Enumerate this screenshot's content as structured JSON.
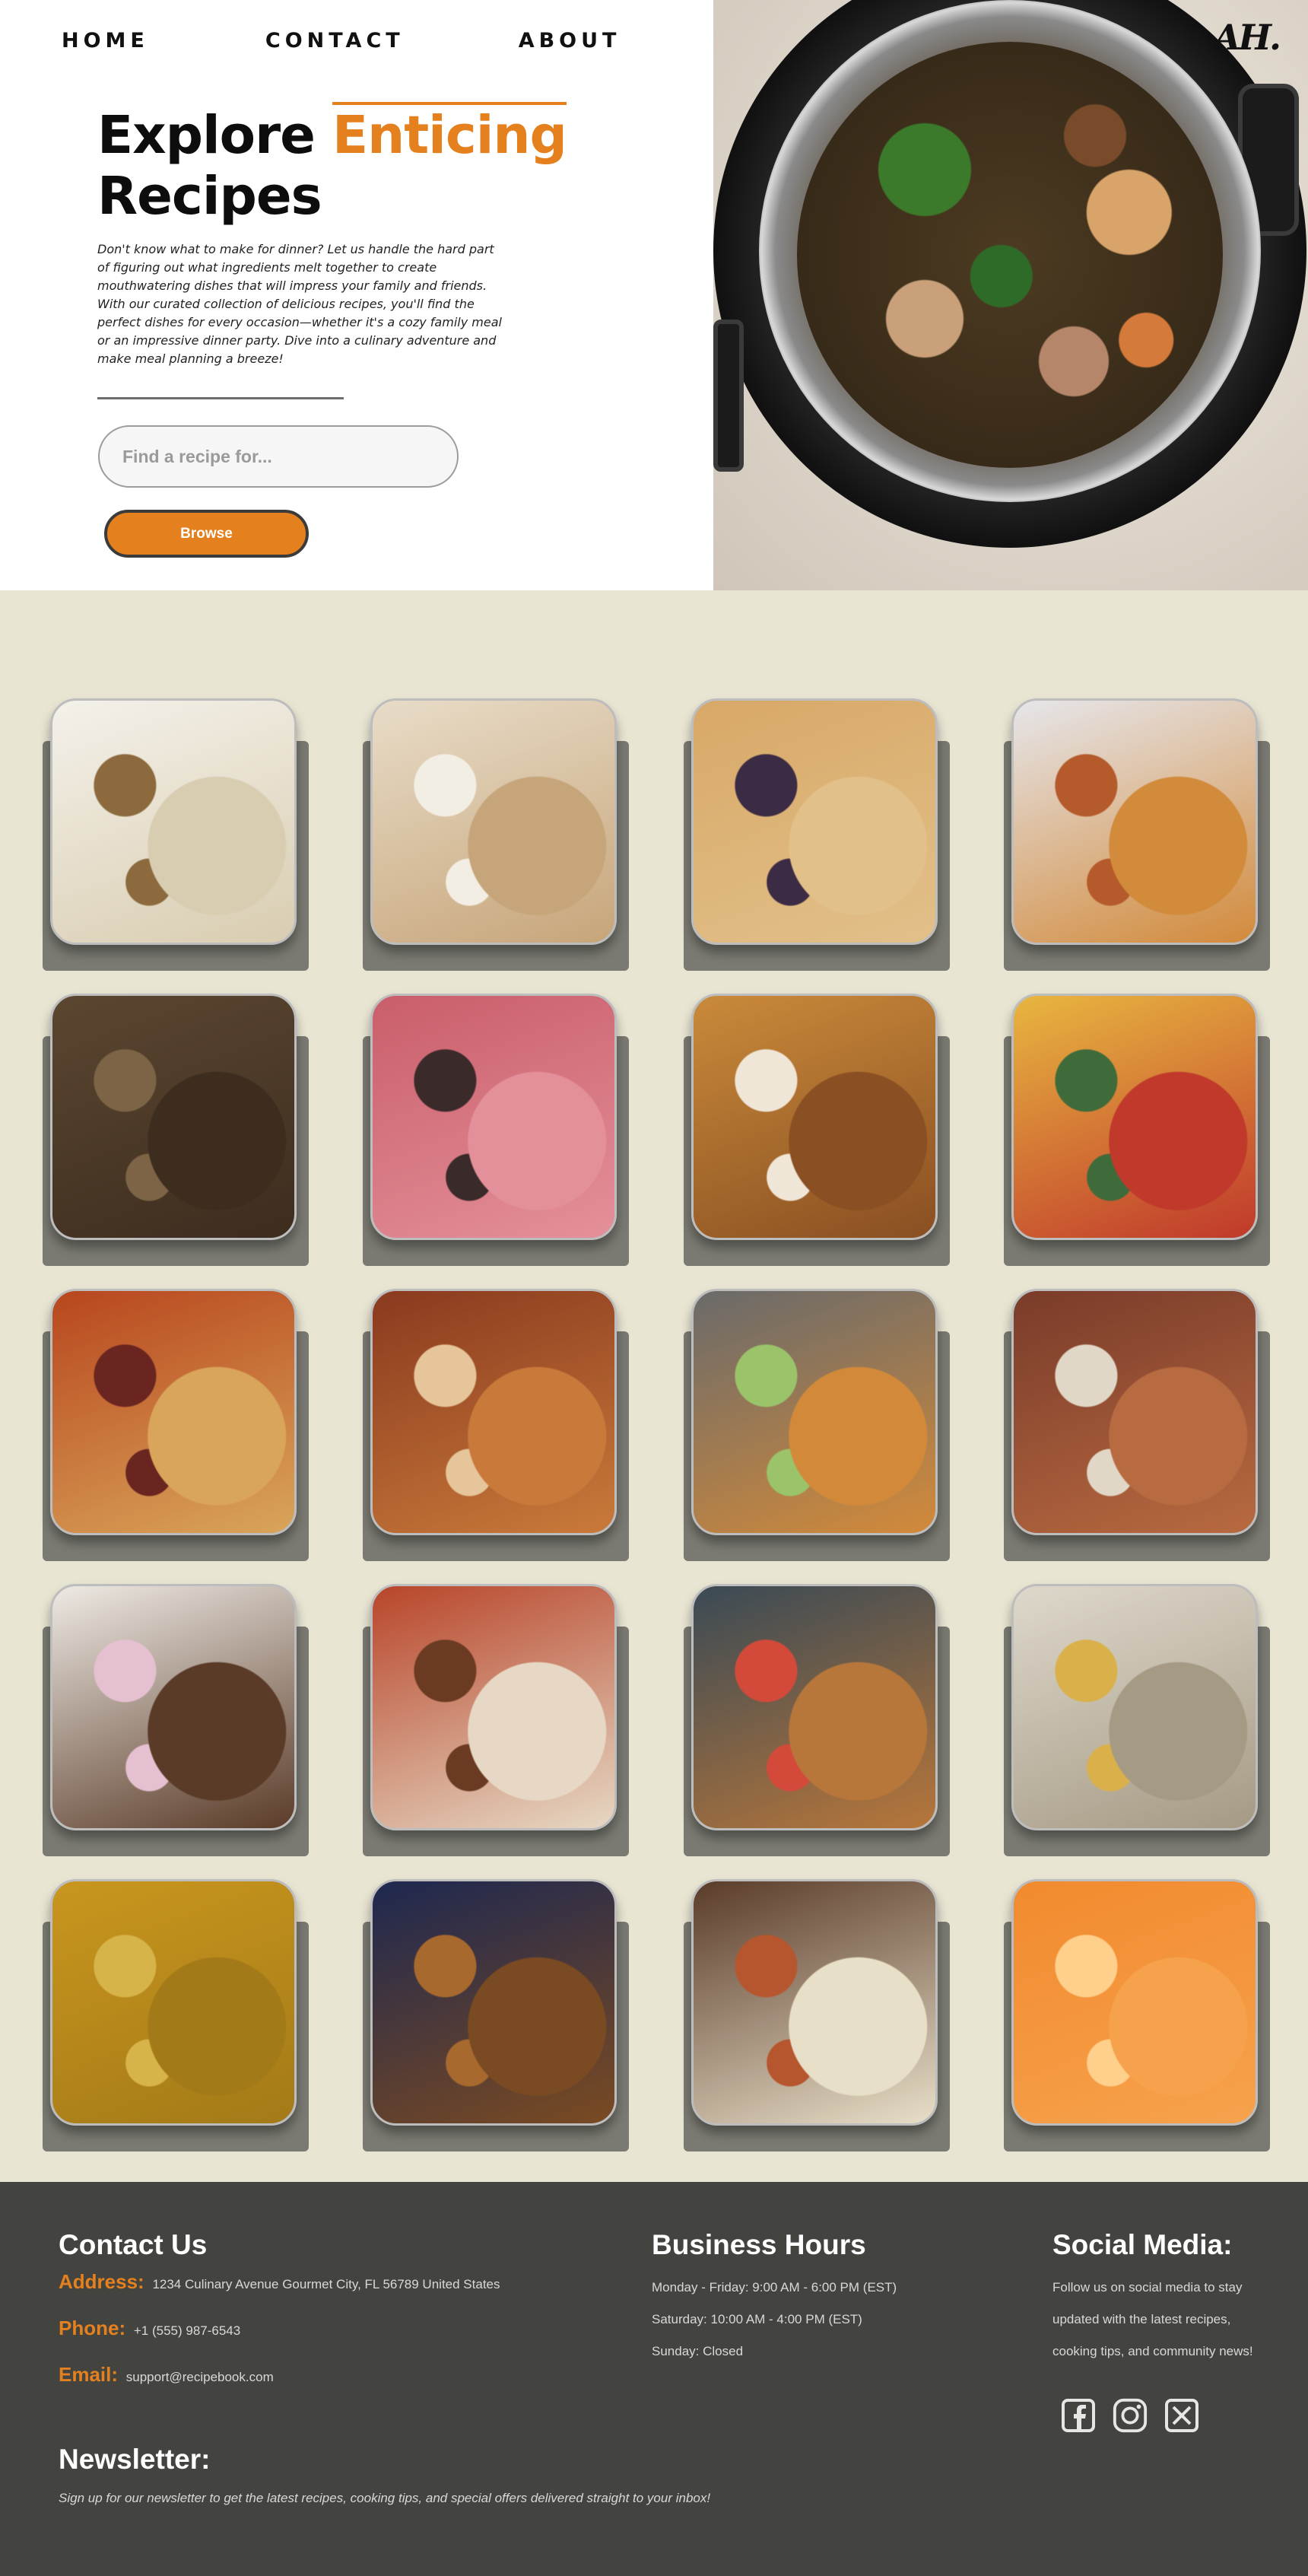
{
  "nav": {
    "home": "HOME",
    "contact": "CONTACT",
    "about": "ABOUT"
  },
  "hero": {
    "title_part1": "Explore ",
    "title_accent": "Enticing",
    "title_part2": "Recipes",
    "intro": "Don't know what to make for dinner? Let us handle the hard part of figuring out what ingredients melt together to create mouthwatering dishes that will impress your family and friends. With our curated collection of delicious recipes, you'll find the perfect dishes for every occasion—whether it's a cozy family meal or an impressive dinner party. Dive into a culinary adventure and make meal planning a breeze!",
    "search_placeholder": "Find a recipe for...",
    "browse_label": "Browse",
    "logo_text": "AH.",
    "image": "instant-pot-vegetable-stew-photo"
  },
  "colors": {
    "accent": "#e5801f",
    "grid_bg": "#e9e5d3",
    "footer_bg": "#434440"
  },
  "recipes": [
    {
      "image": "chicken-salad-flatbread"
    },
    {
      "image": "glazed-cinnamon-roll"
    },
    {
      "image": "blueberry-muffins"
    },
    {
      "image": "spaghetti-plate"
    },
    {
      "image": "chocolate-chip-cookies"
    },
    {
      "image": "pink-macarons"
    },
    {
      "image": "lasagna-slice"
    },
    {
      "image": "pappardelle-tomato-sauce"
    },
    {
      "image": "penne-with-meatballs"
    },
    {
      "image": "chocolate-crepe-cake"
    },
    {
      "image": "sweet-potato-tacos"
    },
    {
      "image": "seafood-platter"
    },
    {
      "image": "loaded-sweet-potato-with-sprinkles"
    },
    {
      "image": "spaghetti-bolognese-bowl"
    },
    {
      "image": "bruschetta-chicken-toast"
    },
    {
      "image": "baked-potato-with-cheese"
    },
    {
      "image": "lentil-vegetable-curry"
    },
    {
      "image": "fried-chicken"
    },
    {
      "image": "shrimp-and-grits"
    },
    {
      "image": "orange-drinks"
    }
  ],
  "footer": {
    "contact_heading": "Contact Us",
    "address_label": "Address:",
    "address_value": "1234 Culinary Avenue Gourmet City, FL 56789 United States",
    "phone_label": "Phone:",
    "phone_value": "+1 (555) 987-6543",
    "email_label": "Email:",
    "email_value": "support@recipebook.com",
    "hours_heading": "Business Hours",
    "hours": [
      "Monday - Friday: 9:00 AM - 6:00 PM (EST)",
      "Saturday: 10:00 AM - 4:00 PM (EST)",
      "Sunday: Closed"
    ],
    "social_heading": "Social Media:",
    "social_text": "Follow us on social media to stay updated with the latest recipes, cooking tips, and community news!",
    "social_icons": [
      "facebook-icon",
      "instagram-icon",
      "x-twitter-icon"
    ],
    "newsletter_heading": "Newsletter:",
    "newsletter_text": "Sign up for our newsletter to get the latest recipes, cooking tips, and special offers delivered straight to your inbox!"
  }
}
